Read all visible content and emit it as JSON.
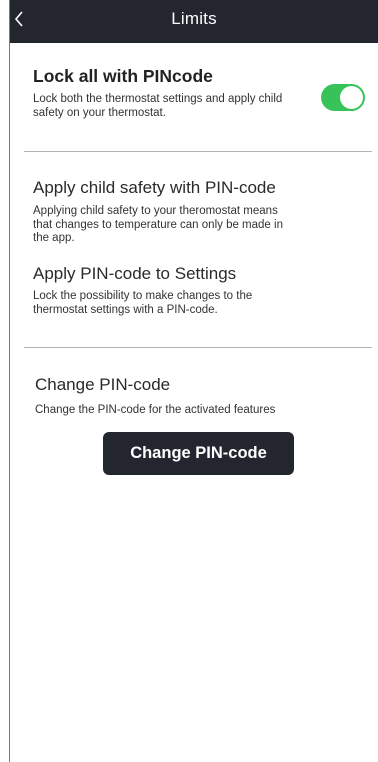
{
  "header": {
    "title": "Limits",
    "back_icon": "chevron-left-icon"
  },
  "lock_all": {
    "title": "Lock all with PINcode",
    "description_lines": [
      "Lock both the thermostat settings and apply child",
      "safety on your thermostat."
    ],
    "toggle_on": true,
    "toggle_color": "#37c25a"
  },
  "child_safety": {
    "title": "Apply child safety with PIN-code",
    "description_lines": [
      "Applying child safety to your theromostat means",
      "that changes to temperature can only be made in",
      "the app."
    ]
  },
  "settings_pin": {
    "title": "Apply PIN-code to Settings",
    "description_lines": [
      "Lock the possibility to make changes to the",
      "thermostat settings with a PIN-code."
    ]
  },
  "change_pin": {
    "title": "Change PIN-code",
    "description": "Change the PIN-code for the activated features",
    "button_label": "Change PIN-code"
  },
  "colors": {
    "navbar": "#23262f",
    "button": "#23262f",
    "divider": "#b3b3b3"
  }
}
